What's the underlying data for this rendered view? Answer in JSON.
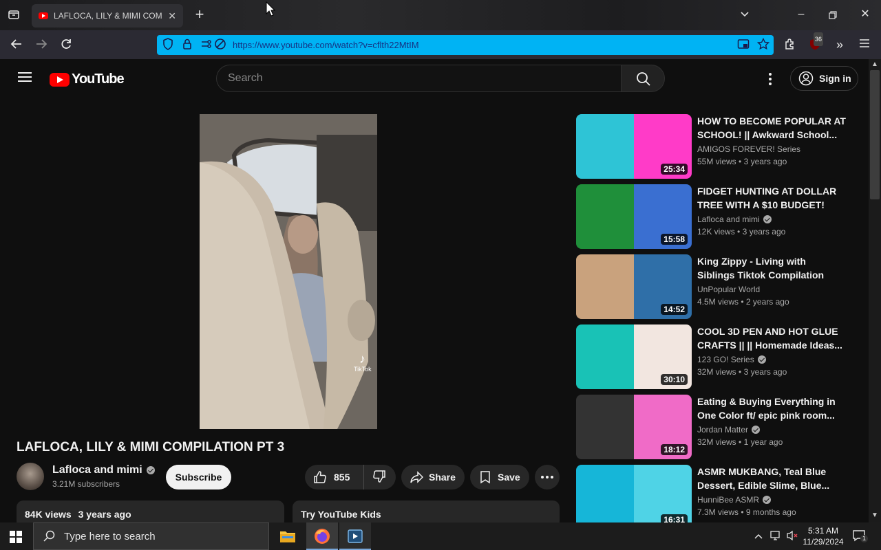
{
  "browser": {
    "tab_title": "LAFLOCA, LILY & MIMI COMPI",
    "url": "https://www.youtube.com/watch?v=cflth22MtIM",
    "extension_badge": "36"
  },
  "youtube": {
    "logo_text": "YouTube",
    "search_placeholder": "Search",
    "sign_in_label": "Sign in"
  },
  "video": {
    "title": "LAFLOCA, LILY & MIMI COMPILATION PT 3",
    "tiktok_watermark": "TikTok",
    "channel_name": "Lafloca and mimi",
    "subscribers": "3.21M subscribers",
    "subscribe_label": "Subscribe",
    "likes": "855",
    "share_label": "Share",
    "save_label": "Save",
    "views": "84K views",
    "age": "3 years ago",
    "promo_label": "Try YouTube Kids"
  },
  "recommendations": [
    {
      "title": "HOW TO BECOME POPULAR AT SCHOOL! || Awkward School...",
      "channel": "AMIGOS FOREVER! Series",
      "verified": false,
      "views": "55M views",
      "age": "3 years ago",
      "duration": "25:34",
      "colors": [
        "#2ec4d6",
        "#ff3bc8"
      ]
    },
    {
      "title": "FIDGET HUNTING AT DOLLAR TREE WITH A $10 BUDGET!",
      "channel": "Lafloca and mimi",
      "verified": true,
      "views": "12K views",
      "age": "3 years ago",
      "duration": "15:58",
      "colors": [
        "#1f8f3a",
        "#3a6fd1"
      ]
    },
    {
      "title": "King Zippy - Living with Siblings Tiktok Compilation",
      "channel": "UnPopular World",
      "verified": false,
      "views": "4.5M views",
      "age": "2 years ago",
      "duration": "14:52",
      "colors": [
        "#c9a27d",
        "#2f6fa8"
      ]
    },
    {
      "title": "COOL 3D PEN AND HOT GLUE CRAFTS || || Homemade Ideas...",
      "channel": "123 GO! Series",
      "verified": true,
      "views": "32M views",
      "age": "3 years ago",
      "duration": "30:10",
      "colors": [
        "#19c2b6",
        "#f2e6e0"
      ]
    },
    {
      "title": "Eating & Buying Everything in One Color ft/ epic pink room...",
      "channel": "Jordan Matter",
      "verified": true,
      "views": "32M views",
      "age": "1 year ago",
      "duration": "18:12",
      "colors": [
        "#333333",
        "#f06bc7"
      ]
    },
    {
      "title": "ASMR MUKBANG, Teal Blue Dessert, Edible Slime, Blue...",
      "channel": "HunniBee ASMR",
      "verified": true,
      "views": "7.3M views",
      "age": "9 months ago",
      "duration": "16:31",
      "colors": [
        "#16b6d8",
        "#4fd3e6"
      ]
    }
  ],
  "taskbar": {
    "search_placeholder": "Type here to search",
    "time": "5:31 AM",
    "date": "11/29/2024",
    "notification_count": "1"
  }
}
